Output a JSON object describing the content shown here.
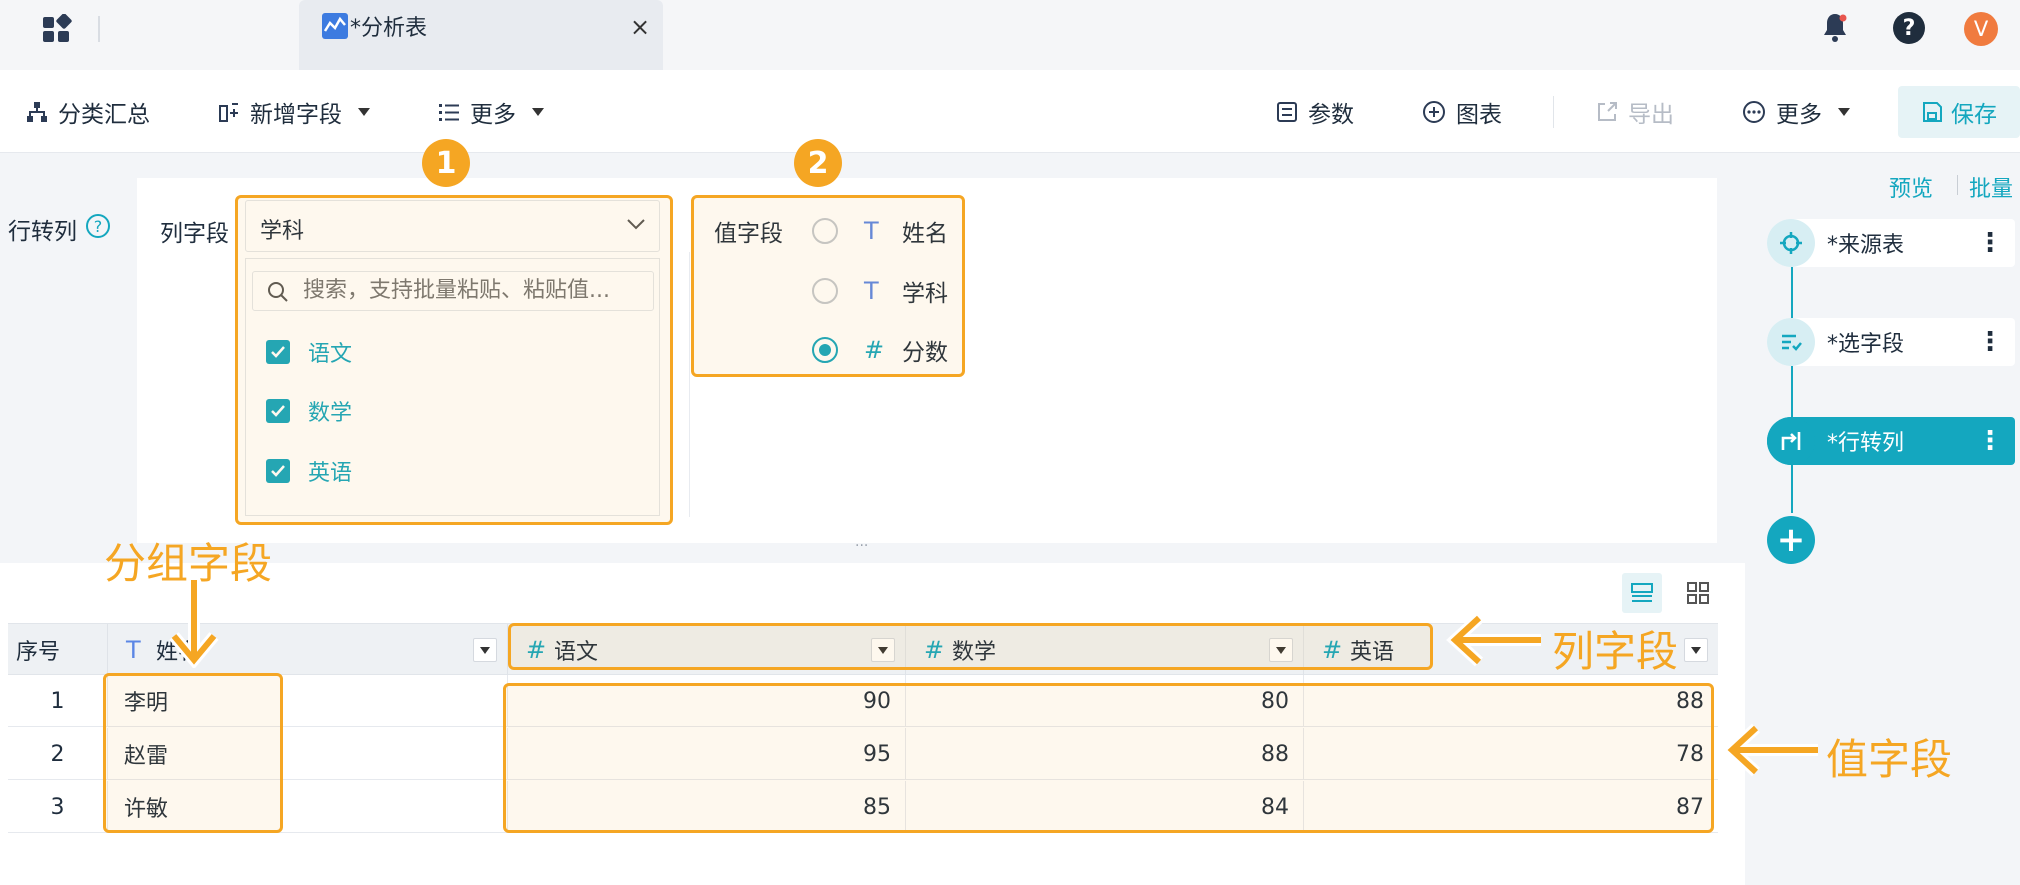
{
  "tab": {
    "title": "*分析表",
    "close": "×"
  },
  "header_icons": {
    "notification": "bell-icon",
    "help": "?",
    "avatar": "V"
  },
  "toolbar": {
    "group_summary": "分类汇总",
    "add_field": "新增字段",
    "more_left": "更多",
    "params": "参数",
    "chart": "图表",
    "export": "导出",
    "more_right": "更多",
    "save": "保存"
  },
  "config": {
    "section_label": "行转列",
    "help": "?",
    "column_field_label": "列字段",
    "column_field_value": "学科",
    "search_placeholder": "搜索，支持批量粘贴、粘贴值...",
    "column_options": [
      "语文",
      "数学",
      "英语"
    ],
    "value_field_label": "值字段",
    "value_options": [
      {
        "type": "T",
        "label": "姓名",
        "selected": false
      },
      {
        "type": "T",
        "label": "学科",
        "selected": false
      },
      {
        "type": "#",
        "label": "分数",
        "selected": true
      }
    ],
    "resize_handle": "···"
  },
  "annotations": {
    "badge1": "1",
    "badge2": "2",
    "group_field": "分组字段",
    "column_field": "列字段",
    "value_field": "值字段"
  },
  "table": {
    "columns": [
      {
        "type": "",
        "label": "序号"
      },
      {
        "type": "T",
        "label": "姓名"
      },
      {
        "type": "#",
        "label": "语文"
      },
      {
        "type": "#",
        "label": "数学"
      },
      {
        "type": "#",
        "label": "英语"
      }
    ],
    "rows": [
      {
        "index": "1",
        "name": "李明",
        "chinese": "90",
        "math": "80",
        "english": "88"
      },
      {
        "index": "2",
        "name": "赵雷",
        "chinese": "95",
        "math": "88",
        "english": "78"
      },
      {
        "index": "3",
        "name": "许敏",
        "chinese": "85",
        "math": "84",
        "english": "87"
      }
    ]
  },
  "sidebar": {
    "preview": "预览",
    "batch": "批量",
    "steps": [
      {
        "label": "*来源表",
        "icon": "crosshair-icon",
        "active": false
      },
      {
        "label": "*选字段",
        "icon": "field-select-icon",
        "active": false
      },
      {
        "label": "*行转列",
        "icon": "pivot-icon",
        "active": true
      }
    ],
    "add": "+",
    "more": "⋮"
  },
  "colors": {
    "accent": "#14a7bf",
    "annotation": "#f5a623"
  }
}
